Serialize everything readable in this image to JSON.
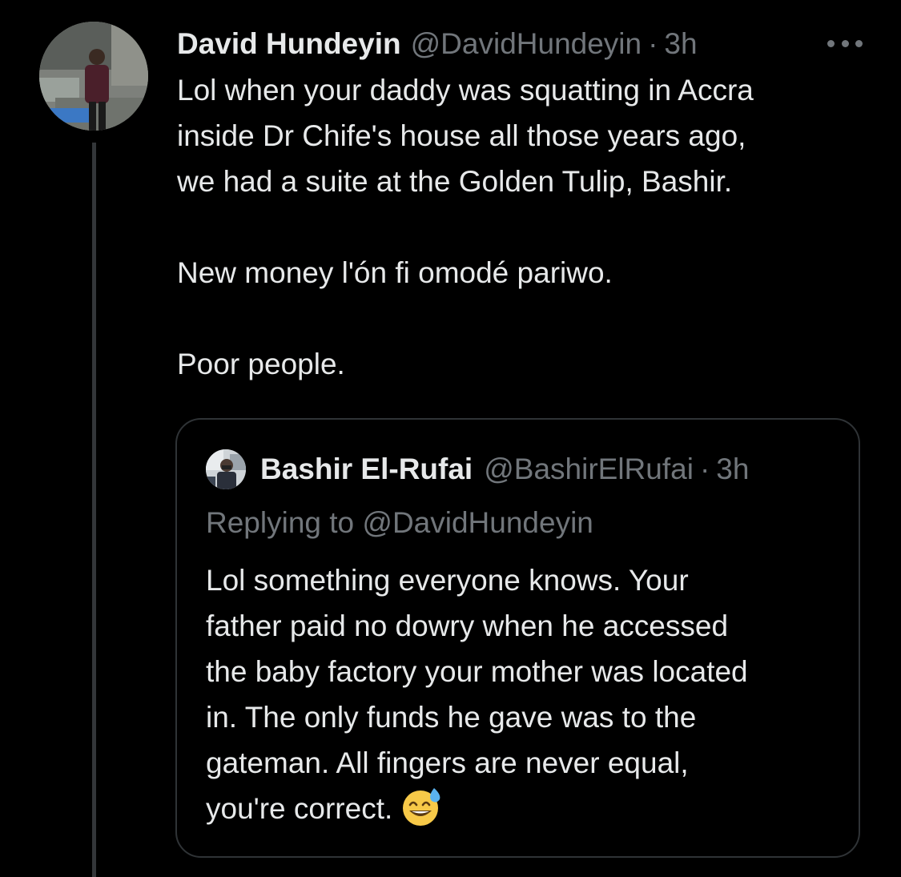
{
  "tweet": {
    "author_name": "David Hundeyin",
    "author_handle": "@DavidHundeyin",
    "separator": "·",
    "time": "3h",
    "more_icon": "more-horizontal-icon",
    "lines": [
      "Lol when your daddy was squatting in Accra",
      "inside Dr Chife's house all those years ago,",
      "we had a suite at the Golden Tulip, Bashir.",
      "New money l'ón fi omodé pariwo.",
      "Poor people."
    ]
  },
  "quoted_tweet": {
    "author_name": "Bashir El-Rufai",
    "author_handle": "@BashirElRufai",
    "separator": "·",
    "time": "3h",
    "replying_prefix": "Replying to",
    "replying_to": "@DavidHundeyin",
    "lines": [
      "Lol something everyone knows. Your",
      "father paid no dowry when he accessed",
      "the baby factory your mother was located",
      "in. The only funds he gave was to the",
      "gateman. All fingers are never equal,",
      "you're correct."
    ],
    "emoji": "sweat-smile-emoji"
  },
  "colors": {
    "background": "#000000",
    "primary_text": "#e7e9ea",
    "secondary_text": "#71767b",
    "border": "#2f3336"
  }
}
